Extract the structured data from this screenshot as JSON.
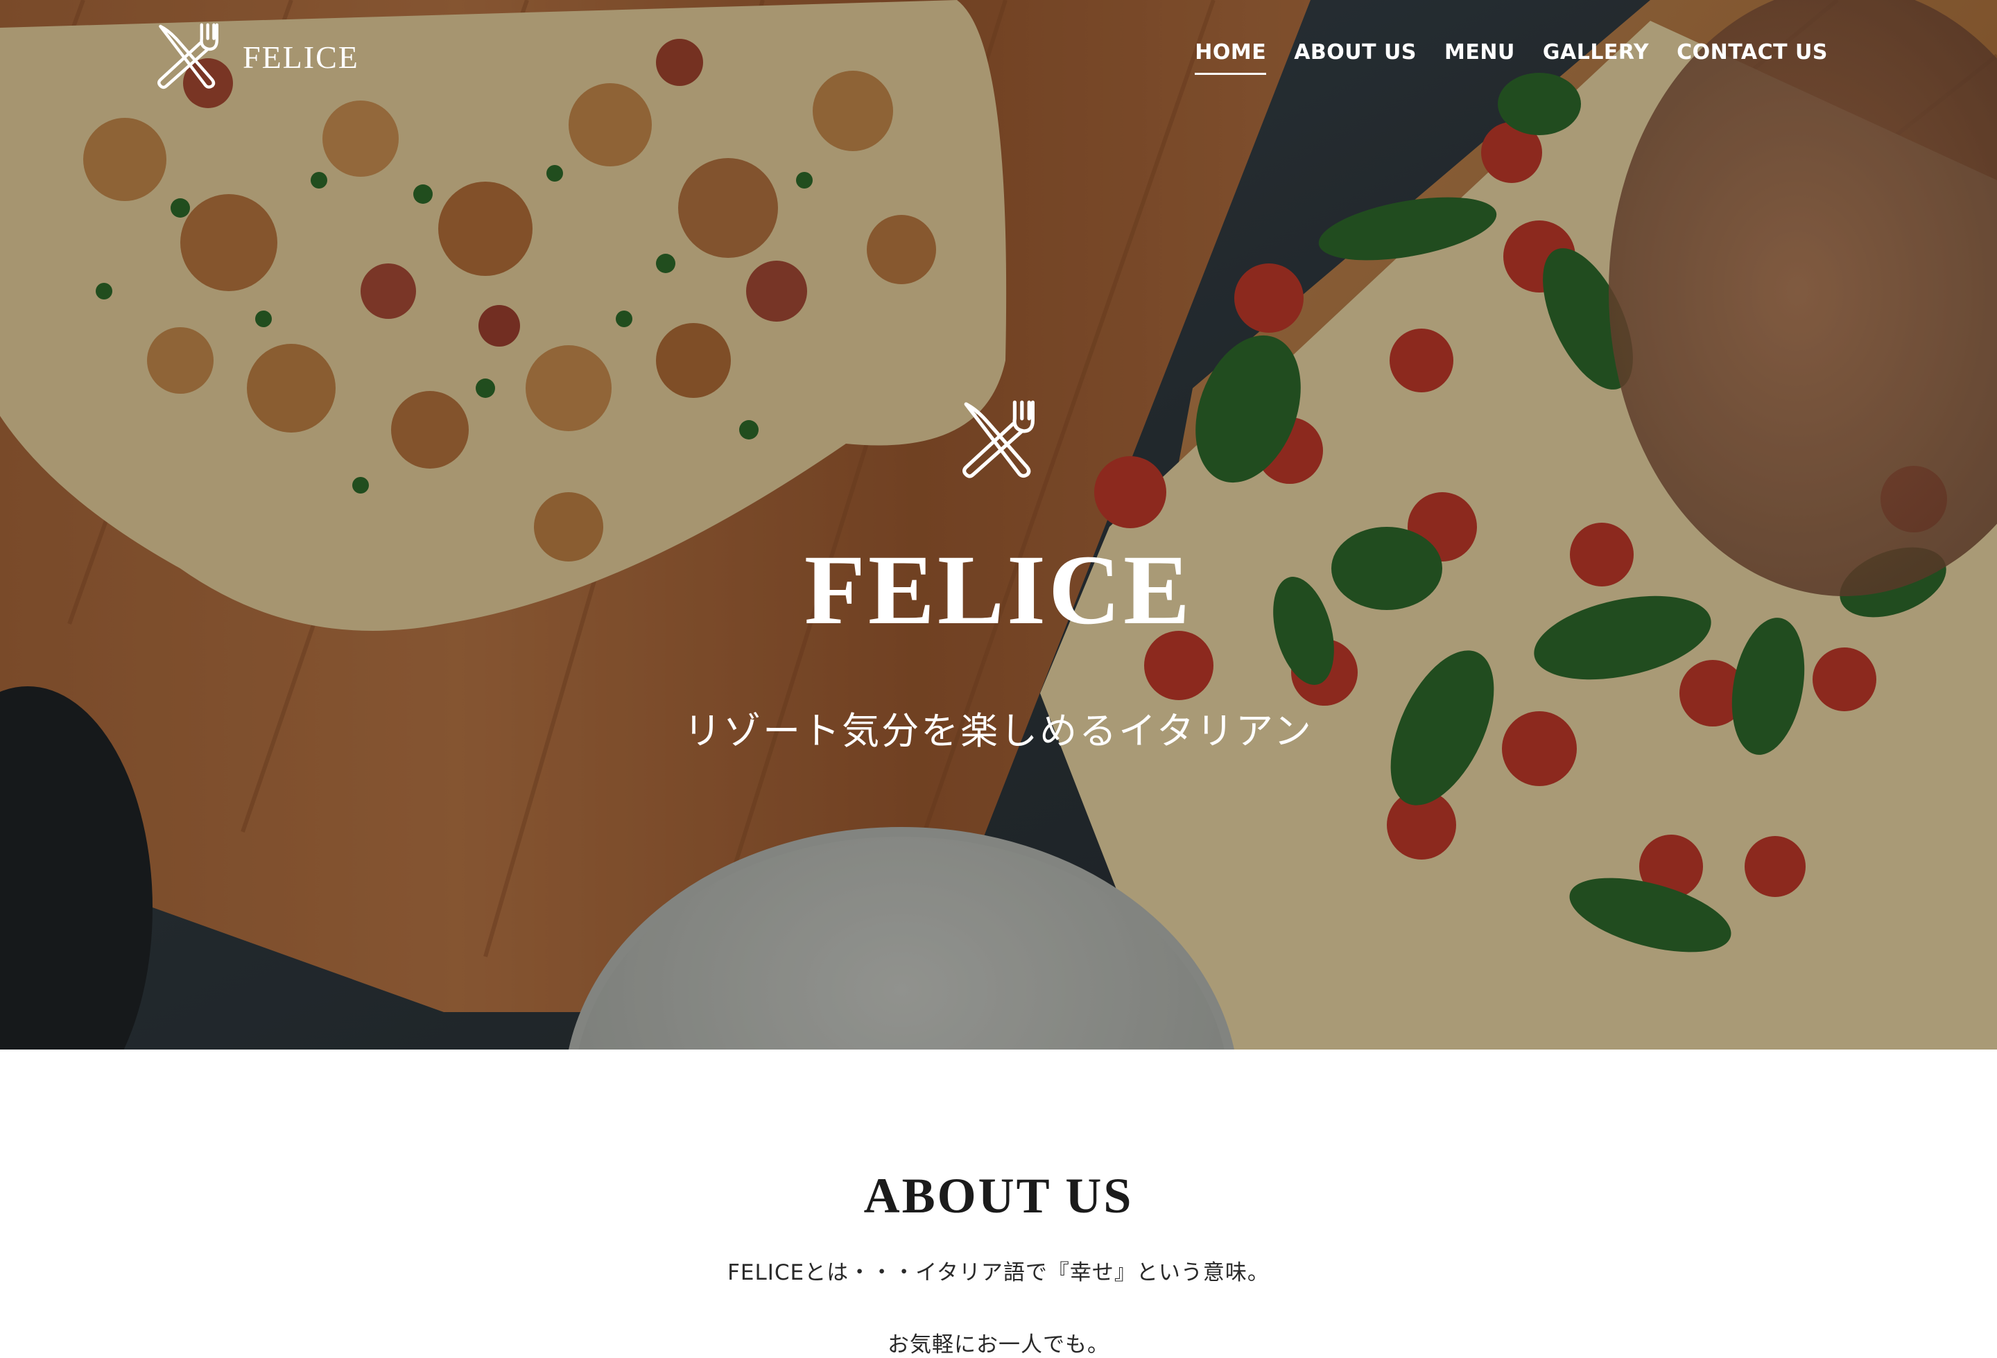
{
  "header": {
    "brand_name": "FELICE",
    "brand_icon": "fork-knife-icon",
    "nav": [
      {
        "label": "HOME",
        "active": true
      },
      {
        "label": "ABOUT US",
        "active": false
      },
      {
        "label": "MENU",
        "active": false
      },
      {
        "label": "GALLERY",
        "active": false
      },
      {
        "label": "CONTACT US",
        "active": false
      }
    ]
  },
  "hero": {
    "icon": "fork-knife-icon",
    "title": "FELICE",
    "tagline": "リゾート気分を楽しめるイタリアン"
  },
  "about": {
    "title": "ABOUT US",
    "line1": "FELICEとは・・・イタリア語で『幸せ』という意味。",
    "line2": "お気軽にお一人でも。"
  },
  "colors": {
    "text_light": "#ffffff",
    "text_dark": "#1b1b1b",
    "hero_overlay": "rgba(0,0,0,0.28)"
  }
}
